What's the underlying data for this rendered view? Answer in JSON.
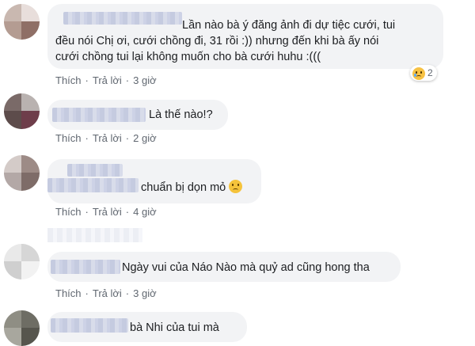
{
  "comments": [
    {
      "text_lines": [
        "Lần nào bà ý đăng ảnh đi dự tiệc cưới, tui",
        "đều nói Chị ơi, cưới chồng đi, 31 rồi :)) nhưng đến khi bà ấy nói",
        "cưới chồng tui lại không muốn cho bà cưới huhu :((("
      ],
      "like_label": "Thích",
      "reply_label": "Trả lời",
      "time": "3 giờ",
      "reaction": {
        "icon": "sad-reaction-icon",
        "count": "2"
      }
    },
    {
      "text": "Là thế nào!?",
      "like_label": "Thích",
      "reply_label": "Trả lời",
      "time": "2 giờ"
    },
    {
      "text": "chuẩn bị dọn mỏ",
      "emoji": "sad-face-emoji",
      "like_label": "Thích",
      "reply_label": "Trả lời",
      "time": "4 giờ"
    },
    {
      "text": "Ngày vui của Náo Nào mà quỷ ad cũng hong tha",
      "like_label": "Thích",
      "reply_label": "Trả lời",
      "time": "3 giờ"
    },
    {
      "text": "bà Nhi của tui mà"
    }
  ],
  "colors": {
    "bubble": "#f2f3f5",
    "action_text": "#606770",
    "body_text": "#1c1e21",
    "reaction_yellow": "#f7c244"
  }
}
